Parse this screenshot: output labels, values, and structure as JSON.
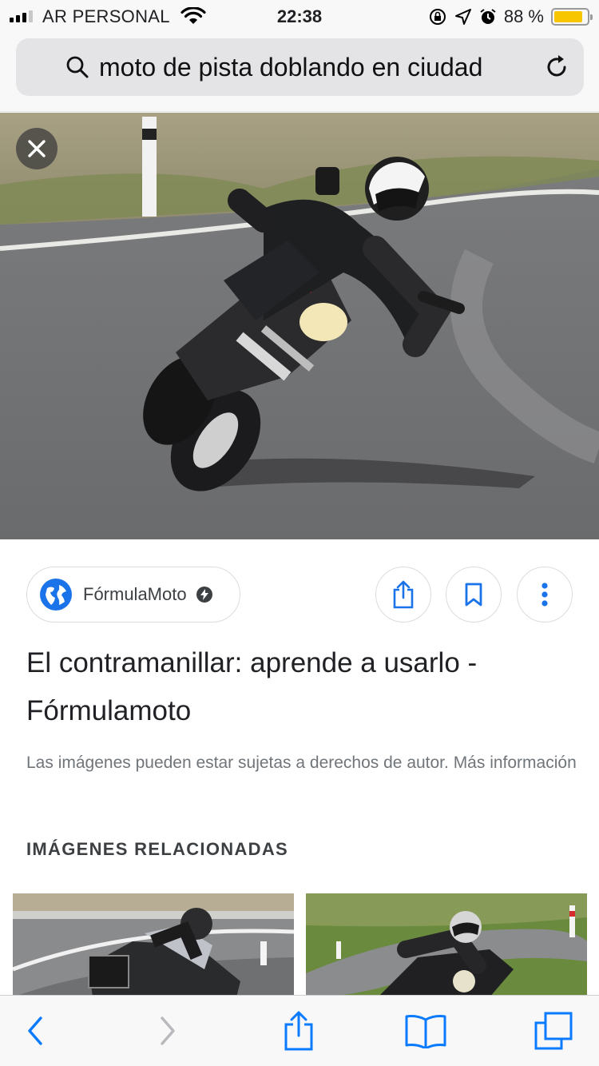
{
  "status_bar": {
    "carrier": "AR PERSONAL",
    "time": "22:38",
    "battery_percent": "88 %",
    "battery_level": 0.88,
    "icons": [
      "signal-icon",
      "wifi-icon",
      "screen-lock-icon",
      "location-icon",
      "alarm-icon",
      "battery-icon"
    ]
  },
  "address_bar": {
    "query": "moto de pista doblando en ciudad",
    "icons": [
      "search-icon",
      "reload-icon"
    ]
  },
  "viewer": {
    "close_icon": "close-icon",
    "source": {
      "name": "FórmulaMoto",
      "icons": [
        "globe-icon",
        "amp-bolt-icon"
      ]
    },
    "actions": [
      "share-icon",
      "bookmark-icon",
      "more-vert-icon"
    ],
    "title": "El contramanillar: aprende a usarlo - Fórmulamoto",
    "notice": "Las imágenes pueden estar sujetas a derechos de autor. Más información",
    "related_heading": "IMÁGENES RELACIONADAS"
  },
  "toolbar": {
    "icons": [
      "back-icon",
      "forward-icon",
      "share-icon",
      "bookmarks-icon",
      "tabs-icon"
    ]
  },
  "colors": {
    "accent_blue": "#1a73e8",
    "safari_blue": "#0a7aff",
    "battery_yellow": "#f7c600"
  }
}
